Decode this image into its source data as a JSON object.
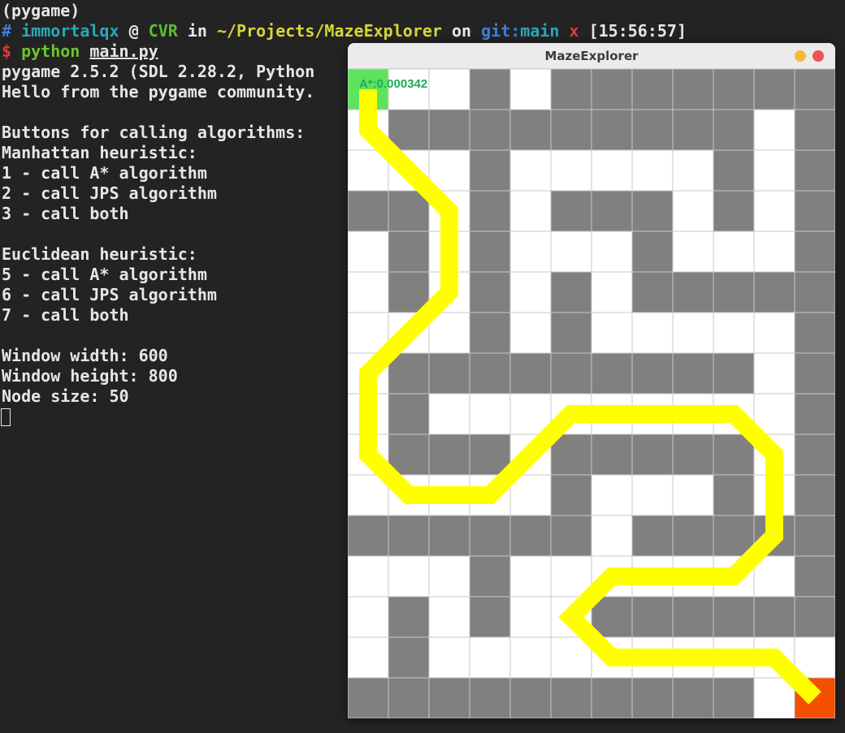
{
  "terminal": {
    "line1": "(pygame)",
    "prompt": {
      "hash": "#",
      "user": "immortalqx",
      "at": "@",
      "host": "CVR",
      "in": "in",
      "path": "~/Projects/MazeExplorer",
      "on": "on",
      "git_label": "git:",
      "branch": "main",
      "dirty": "x",
      "time": "[15:56:57]"
    },
    "command": {
      "dollar": "$",
      "program": "python",
      "file": "main.py"
    },
    "output": [
      "pygame 2.5.2 (SDL 2.28.2, Python",
      "Hello from the pygame community.",
      "",
      "Buttons for calling algorithms:",
      "Manhattan heuristic:",
      "1 - call A* algorithm",
      "2 - call JPS algorithm",
      "3 - call both",
      "",
      "Euclidean heuristic:",
      "5 - call A* algorithm",
      "6 - call JPS algorithm",
      "7 - call both",
      "",
      "Window width: 600",
      "Window height: 800",
      "Node size: 50"
    ]
  },
  "window": {
    "title": "MazeExplorer",
    "timing_label": "A*:0.000342"
  },
  "maze": {
    "columns": 12,
    "rows": 16,
    "legend": {
      "0": "open",
      "1": "wall",
      "2": "start",
      "3": "goal"
    },
    "grid": [
      "200101111111",
      "011111111101",
      "000100000101",
      "110101110101",
      "010100010001",
      "010101011111",
      "000101000001",
      "011111111101",
      "010000000001",
      "011101111101",
      "000001000101",
      "111111011111",
      "000100000001",
      "010100111111",
      "010000000000",
      "111111111103"
    ],
    "path_cells": [
      [
        0,
        0
      ],
      [
        0,
        1
      ],
      [
        1,
        2
      ],
      [
        2,
        3
      ],
      [
        2,
        4
      ],
      [
        2,
        5
      ],
      [
        1,
        6
      ],
      [
        0,
        7
      ],
      [
        0,
        8
      ],
      [
        0,
        9
      ],
      [
        1,
        10
      ],
      [
        2,
        10
      ],
      [
        3,
        10
      ],
      [
        4,
        9
      ],
      [
        5,
        8
      ],
      [
        6,
        8
      ],
      [
        7,
        8
      ],
      [
        8,
        8
      ],
      [
        9,
        8
      ],
      [
        10,
        9
      ],
      [
        10,
        10
      ],
      [
        10,
        11
      ],
      [
        9,
        12
      ],
      [
        8,
        12
      ],
      [
        7,
        12
      ],
      [
        6,
        12
      ],
      [
        5,
        13
      ],
      [
        6,
        14
      ],
      [
        7,
        14
      ],
      [
        8,
        14
      ],
      [
        9,
        14
      ],
      [
        10,
        14
      ],
      [
        11,
        15
      ]
    ],
    "colors": {
      "open": "#ffffff",
      "wall": "#808080",
      "grid_line": "#c8c8c8",
      "start": "#5fe35f",
      "goal": "#f24f00",
      "path": "#ffff00",
      "timing_text": "#22aa55"
    }
  }
}
